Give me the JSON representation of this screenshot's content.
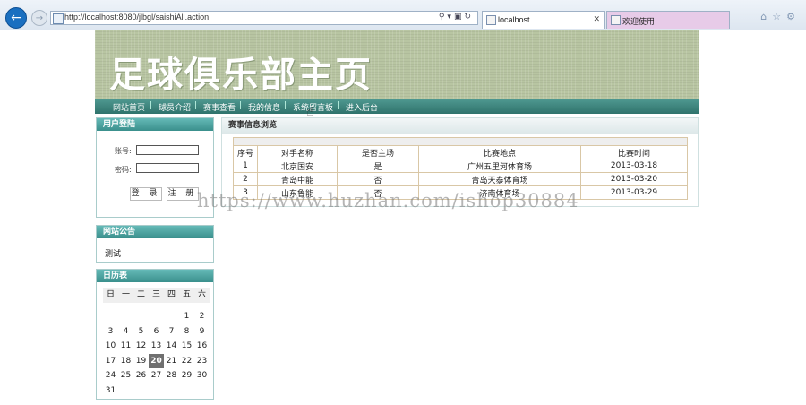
{
  "browser": {
    "url": "http://localhost:8080/jlbgl/saishiAll.action",
    "tabs": [
      {
        "label": "localhost"
      },
      {
        "label": "欢迎使用"
      }
    ]
  },
  "banner": {
    "title": "足球俱乐部主页"
  },
  "nav": {
    "items": [
      "网站首页",
      "球员介绍",
      "赛事查看",
      "我的信息",
      "系统留言板",
      "进入后台"
    ],
    "separator": "|"
  },
  "login": {
    "title": "用户登陆",
    "account_label": "账号:",
    "password_label": "密码:",
    "account_value": "",
    "password_value": "",
    "login_button": "登 录",
    "register_button": "注 册"
  },
  "notice": {
    "title": "网站公告",
    "text": "测试"
  },
  "calendar": {
    "title": "日历表",
    "weekdays": [
      "日",
      "一",
      "二",
      "三",
      "四",
      "五",
      "六"
    ],
    "weeks": [
      [
        "",
        "",
        "",
        "",
        "",
        "1",
        "2"
      ],
      [
        "3",
        "4",
        "5",
        "6",
        "7",
        "8",
        "9"
      ],
      [
        "10",
        "11",
        "12",
        "13",
        "14",
        "15",
        "16"
      ],
      [
        "17",
        "18",
        "19",
        "20",
        "21",
        "22",
        "23"
      ],
      [
        "24",
        "25",
        "26",
        "27",
        "28",
        "29",
        "30"
      ],
      [
        "31",
        "",
        "",
        "",
        "",
        "",
        ""
      ]
    ],
    "today": "20"
  },
  "main": {
    "title": "赛事信息浏览",
    "columns": [
      "序号",
      "对手名称",
      "是否主场",
      "比赛地点",
      "比赛时间"
    ],
    "rows": [
      [
        "1",
        "北京国安",
        "是",
        "广州五里河体育场",
        "2013-03-18"
      ],
      [
        "2",
        "青岛中能",
        "否",
        "青岛天泰体育场",
        "2013-03-20"
      ],
      [
        "3",
        "山东鲁能",
        "否",
        "济南体育场",
        "2013-03-29"
      ]
    ]
  },
  "watermark": "https://www.huzhan.com/ishop30884"
}
